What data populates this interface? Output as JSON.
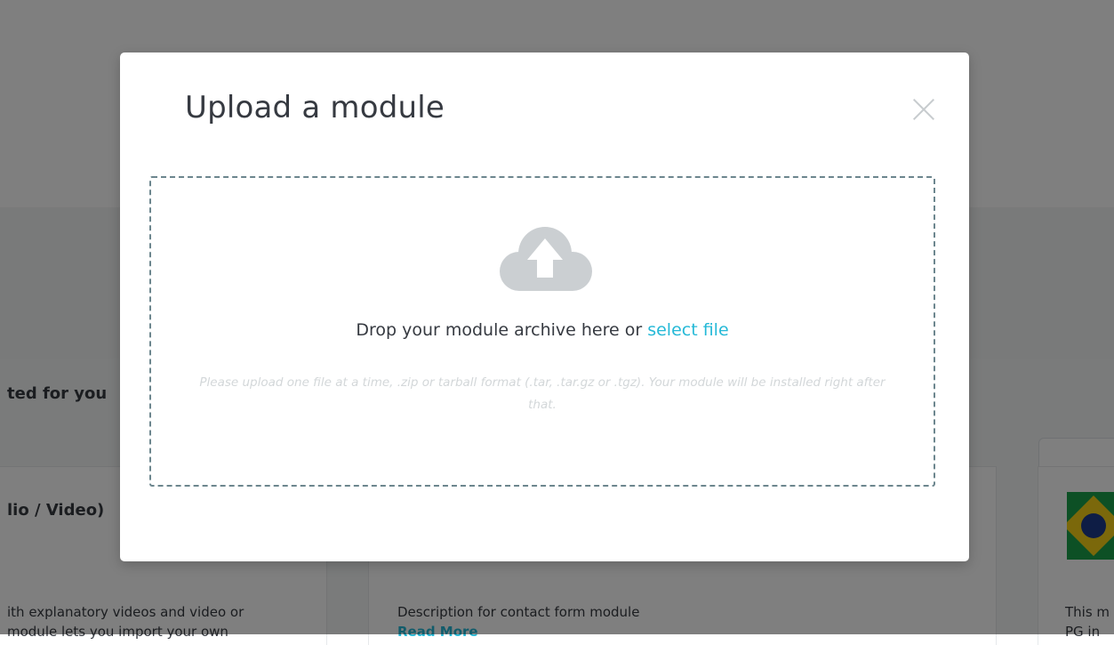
{
  "background": {
    "section_title": "ted for you",
    "cards": [
      {
        "title": "lio / Video)",
        "desc_line1": "ith explanatory videos and video or",
        "desc_line2": "module lets you import your own"
      },
      {
        "title": "",
        "desc_line1": "Description for contact form module",
        "read_more": "Read More"
      },
      {
        "title": "",
        "desc_line1": "This m",
        "desc_line2": "PG in"
      }
    ],
    "search_icon": "search-icon"
  },
  "modal": {
    "title": "Upload a module",
    "close_icon": "close-icon",
    "dropzone": {
      "upload_icon": "cloud-upload-icon",
      "text_prefix": "Drop your module archive here or ",
      "select_link": "select file",
      "hint": "Please upload one file at a time, .zip or tarball format (.tar, .tar.gz or .tgz). Your module will be installed right after that."
    }
  },
  "colors": {
    "accent": "#25b9d7",
    "text": "#363a41",
    "dashed_border": "#6c868e",
    "hint_text": "#d3d7d9",
    "cloud": "#cbcfd2"
  }
}
